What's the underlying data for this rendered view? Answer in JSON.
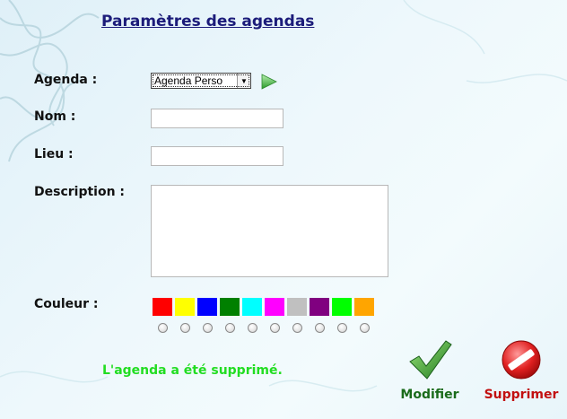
{
  "page": {
    "title": "Paramètres des agendas"
  },
  "form": {
    "agenda_label": "Agenda :",
    "agenda_selected": "Agenda Perso",
    "nom_label": "Nom :",
    "nom_value": "",
    "lieu_label": "Lieu :",
    "lieu_value": "",
    "description_label": "Description :",
    "description_value": "",
    "couleur_label": "Couleur :"
  },
  "colors": [
    "#ff0000",
    "#ffff00",
    "#0000ff",
    "#008000",
    "#00ffff",
    "#ff00ff",
    "#c0c0c0",
    "#800080",
    "#00ff00",
    "#ffa500"
  ],
  "status_message": "L'agenda a été supprimé.",
  "actions": {
    "modify_label": "Modifier",
    "delete_label": "Supprimer"
  },
  "icons": {
    "go": "play-arrow-icon",
    "modify": "checkmark-icon",
    "delete": "no-entry-icon"
  }
}
